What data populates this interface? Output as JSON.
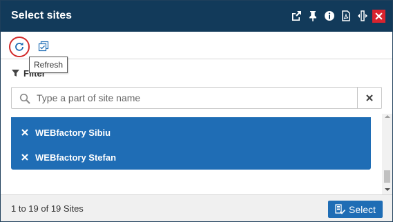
{
  "dialog": {
    "title": "Select sites",
    "header_icons": [
      "popout-icon",
      "pin-icon",
      "info-icon",
      "pdf-icon",
      "resize-icon",
      "close-icon"
    ]
  },
  "toolbar": {
    "refresh_tooltip": "Refresh"
  },
  "filter": {
    "label": "Filter",
    "search_placeholder": "Type a part of site name",
    "search_value": ""
  },
  "list": {
    "items": [
      {
        "label": "WEBfactory Sibiu"
      },
      {
        "label": "WEBfactory Stefan"
      }
    ]
  },
  "footer": {
    "count_text": "1 to 19 of 19 Sites",
    "select_label": "Select"
  },
  "colors": {
    "header_bg": "#123a5a",
    "accent": "#1f6db5",
    "close_red": "#d9232e",
    "highlight_red": "#d22a2a"
  }
}
